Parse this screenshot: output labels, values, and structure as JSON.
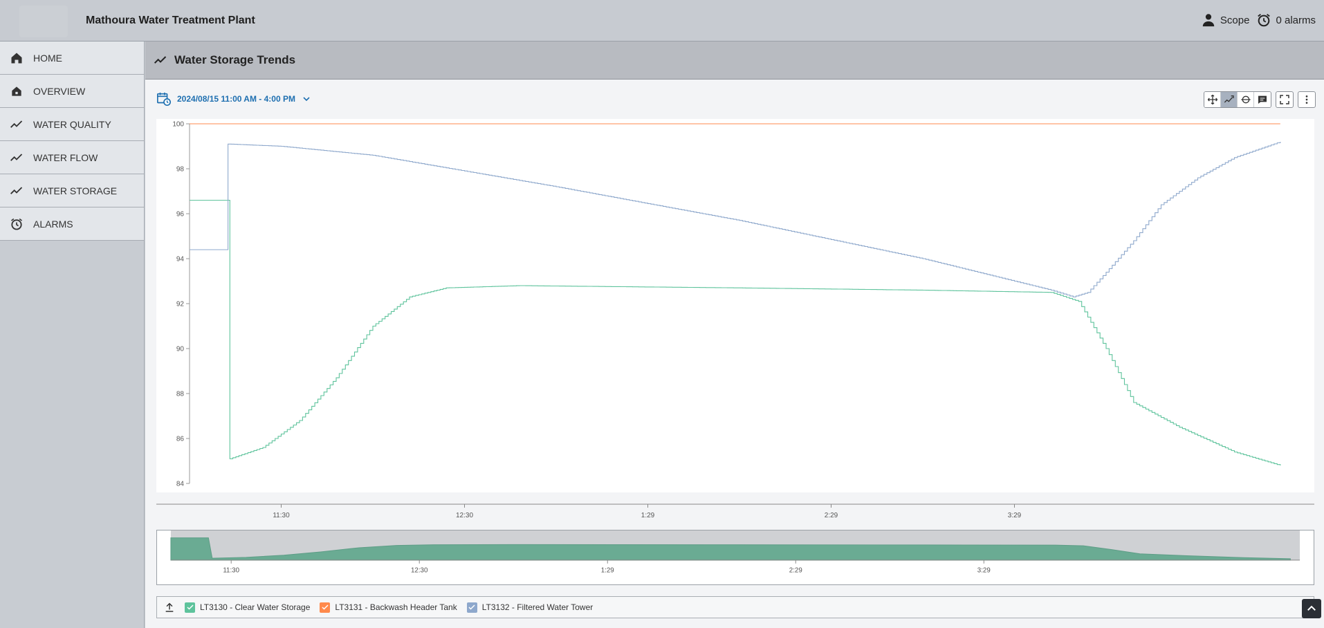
{
  "header": {
    "title": "Mathoura Water Treatment Plant",
    "user_label": "Scope",
    "alarms_label": "0 alarms"
  },
  "sidebar": {
    "items": [
      {
        "label": "HOME",
        "icon": "home-icon"
      },
      {
        "label": "OVERVIEW",
        "icon": "house-icon"
      },
      {
        "label": "WATER QUALITY",
        "icon": "trend-icon"
      },
      {
        "label": "WATER FLOW",
        "icon": "trend-icon"
      },
      {
        "label": "WATER STORAGE",
        "icon": "trend-icon"
      },
      {
        "label": "ALARMS",
        "icon": "alarm-clock-icon"
      }
    ]
  },
  "main": {
    "section_title": "Water Storage Trends",
    "date_range": "2024/08/15 11:00 AM - 4:00 PM"
  },
  "chart_data": {
    "type": "line",
    "ylim": [
      84,
      100
    ],
    "y_ticks": [
      "100",
      "98",
      "96",
      "94",
      "92",
      "90",
      "88",
      "86",
      "84"
    ],
    "x_ticks": [
      "11:30",
      "12:30",
      "1:29",
      "2:29",
      "3:29"
    ],
    "nav_x_ticks": [
      "11:30",
      "12:30",
      "1:29",
      "2:29",
      "3:29"
    ],
    "series": [
      {
        "name": "LT3130 - Clear Water Storage",
        "color": "#5ec39c",
        "points": [
          [
            0,
            96.6
          ],
          [
            0.2,
            96.6
          ],
          [
            0.22,
            85.1
          ],
          [
            0.4,
            85.6
          ],
          [
            0.6,
            86.8
          ],
          [
            0.8,
            88.7
          ],
          [
            1.0,
            91.0
          ],
          [
            1.2,
            92.3
          ],
          [
            1.4,
            92.7
          ],
          [
            1.8,
            92.8
          ],
          [
            3.0,
            92.7
          ],
          [
            4.0,
            92.6
          ],
          [
            4.7,
            92.5
          ],
          [
            4.85,
            92.1
          ],
          [
            5.0,
            90.0
          ],
          [
            5.15,
            87.6
          ],
          [
            5.4,
            86.5
          ],
          [
            5.7,
            85.4
          ],
          [
            5.95,
            84.8
          ]
        ]
      },
      {
        "name": "LT3131 - Backwash Header Tank",
        "color": "#ff8a4c",
        "points": [
          [
            0,
            100.0
          ],
          [
            5.95,
            100.0
          ]
        ]
      },
      {
        "name": "LT3132 - Filtered Water Tower",
        "color": "#8ea8cc",
        "points": [
          [
            0,
            94.4
          ],
          [
            0.2,
            94.4
          ],
          [
            0.21,
            99.1
          ],
          [
            0.5,
            99.0
          ],
          [
            1.0,
            98.6
          ],
          [
            2.0,
            97.2
          ],
          [
            3.0,
            95.7
          ],
          [
            4.0,
            94.0
          ],
          [
            4.7,
            92.6
          ],
          [
            4.82,
            92.3
          ],
          [
            4.9,
            92.5
          ],
          [
            5.0,
            93.4
          ],
          [
            5.15,
            94.8
          ],
          [
            5.3,
            96.4
          ],
          [
            5.5,
            97.6
          ],
          [
            5.7,
            98.5
          ],
          [
            5.95,
            99.2
          ]
        ]
      }
    ],
    "x_domain": [
      0,
      6
    ],
    "x_tick_positions": [
      0.5,
      1.5,
      2.5,
      3.5,
      4.5
    ],
    "legend_position": "bottom-left"
  }
}
